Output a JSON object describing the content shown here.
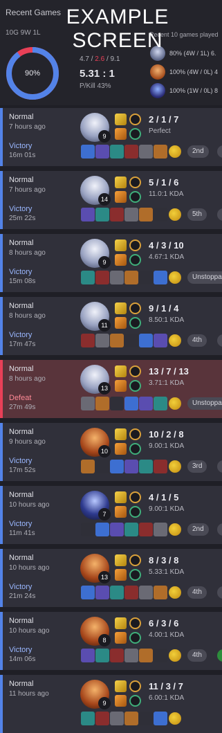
{
  "summary": {
    "title": "Recent Games",
    "record": "10G 9W 1L",
    "winrate": "90%",
    "win_fraction": 0.9,
    "avg_kills": "4.7",
    "avg_deaths": "2.6",
    "avg_assists": "9.1",
    "kda": "5.31 : 1",
    "pkill": "P/Kill 43%",
    "recent_label": "Recent 10 games played",
    "champions": [
      {
        "stat": "80% (4W / 1L)  6.",
        "icon": "champion-portrait-icon"
      },
      {
        "stat": "100% (4W / 0L)  4",
        "icon": "champion-portrait-icon"
      },
      {
        "stat": "100% (1W / 0L)  8",
        "icon": "champion-portrait-icon"
      }
    ]
  },
  "watermark": {
    "line1": "EXAMPLE",
    "line2": "SCREEN"
  },
  "colors": {
    "win": "#5383e8",
    "loss": "#e84057",
    "kda_deaths": "#e84057"
  },
  "matches": [
    {
      "mode": "Normal",
      "time": "7 hours ago",
      "result": "Victory",
      "length": "16m 01s",
      "level": "9",
      "score": "2 / 1 / 7",
      "kda": "Perfect",
      "badge": "2nd",
      "badge2": "Un",
      "green": false,
      "loss": false
    },
    {
      "mode": "Normal",
      "time": "7 hours ago",
      "result": "Victory",
      "length": "25m 22s",
      "level": "14",
      "score": "5 / 1 / 6",
      "kda": "11.0:1 KDA",
      "badge": "5th",
      "badge2": "Ave",
      "green": false,
      "loss": false
    },
    {
      "mode": "Normal",
      "time": "8 hours ago",
      "result": "Victory",
      "length": "15m 08s",
      "level": "9",
      "score": "4 / 3 / 10",
      "kda": "4.67:1 KDA",
      "badge": "Unstoppab",
      "badge2": "",
      "green": false,
      "loss": false
    },
    {
      "mode": "Normal",
      "time": "8 hours ago",
      "result": "Victory",
      "length": "17m 47s",
      "level": "11",
      "score": "9 / 1 / 4",
      "kda": "8.50:1 KDA",
      "badge": "4th",
      "badge2": "Vic",
      "green": false,
      "loss": false
    },
    {
      "mode": "Normal",
      "time": "8 hours ago",
      "result": "Defeat",
      "length": "27m 49s",
      "level": "13",
      "score": "13 / 7 / 13",
      "kda": "3.71:1 KDA",
      "badge": "Unstoppab",
      "badge2": "",
      "green": false,
      "loss": true
    },
    {
      "mode": "Normal",
      "time": "9 hours ago",
      "result": "Victory",
      "length": "17m 52s",
      "level": "10",
      "score": "10 / 2 / 8",
      "kda": "9.00:1 KDA",
      "badge": "3rd",
      "badge2": "Uns",
      "green": false,
      "loss": false
    },
    {
      "mode": "Normal",
      "time": "10 hours ago",
      "result": "Victory",
      "length": "11m 41s",
      "level": "7",
      "score": "4 / 1 / 5",
      "kda": "9.00:1 KDA",
      "badge": "2nd",
      "badge2": "Un",
      "green": false,
      "loss": false
    },
    {
      "mode": "Normal",
      "time": "10 hours ago",
      "result": "Victory",
      "length": "21m 24s",
      "level": "13",
      "score": "8 / 3 / 8",
      "kda": "5.33:1 KDA",
      "badge": "4th",
      "badge2": "Uns",
      "green": false,
      "loss": false
    },
    {
      "mode": "Normal",
      "time": "10 hours ago",
      "result": "Victory",
      "length": "14m 06s",
      "level": "8",
      "score": "6 / 3 / 6",
      "kda": "4.00:1 KDA",
      "badge": "4th",
      "badge2": "Uns",
      "green": true,
      "loss": false
    },
    {
      "mode": "Normal",
      "time": "11 hours ago",
      "result": "",
      "length": "",
      "level": "9",
      "score": "11 / 3 / 7",
      "kda": "6.00:1 KDA",
      "badge": "",
      "badge2": "",
      "green": false,
      "loss": false
    }
  ]
}
